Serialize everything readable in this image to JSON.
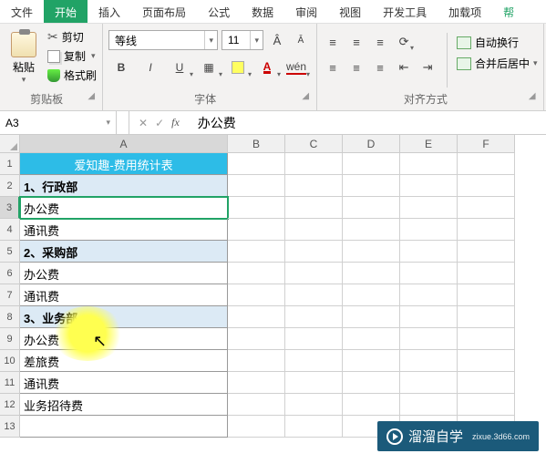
{
  "menu": {
    "file": "文件",
    "home": "开始",
    "insert": "插入",
    "layout": "页面布局",
    "formula": "公式",
    "data": "数据",
    "review": "审阅",
    "view": "视图",
    "dev": "开发工具",
    "addin": "加载项",
    "help": "帮"
  },
  "ribbon": {
    "clipboard": {
      "paste": "粘贴",
      "cut": "剪切",
      "copy": "复制",
      "format": "格式刷",
      "title": "剪贴板"
    },
    "font": {
      "name": "等线",
      "size": "11",
      "title": "字体"
    },
    "align": {
      "wrap": "自动换行",
      "merge": "合并后居中",
      "title": "对齐方式"
    }
  },
  "formula_bar": {
    "name": "A3",
    "value": "办公费"
  },
  "columns": [
    "A",
    "B",
    "C",
    "D",
    "E",
    "F"
  ],
  "rows": [
    {
      "n": "1",
      "a": "爱知趣-费用统计表",
      "cls": "hdr"
    },
    {
      "n": "2",
      "a": "1、行政部",
      "cls": "sub"
    },
    {
      "n": "3",
      "a": "办公费",
      "cls": "sel"
    },
    {
      "n": "4",
      "a": "通讯费",
      "cls": ""
    },
    {
      "n": "5",
      "a": "2、采购部",
      "cls": "sub"
    },
    {
      "n": "6",
      "a": "办公费",
      "cls": ""
    },
    {
      "n": "7",
      "a": "通讯费",
      "cls": ""
    },
    {
      "n": "8",
      "a": "3、业务部",
      "cls": "sub"
    },
    {
      "n": "9",
      "a": "办公费",
      "cls": ""
    },
    {
      "n": "10",
      "a": "差旅费",
      "cls": ""
    },
    {
      "n": "11",
      "a": "通讯费",
      "cls": ""
    },
    {
      "n": "12",
      "a": "业务招待费",
      "cls": ""
    },
    {
      "n": "13",
      "a": "",
      "cls": ""
    }
  ],
  "watermark": {
    "text": "溜溜自学",
    "sub": "zixue.3d66.com"
  }
}
